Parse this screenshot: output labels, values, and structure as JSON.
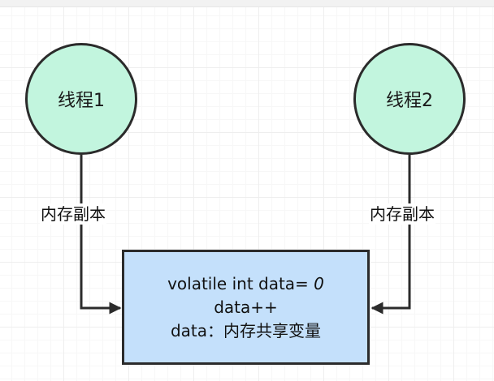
{
  "nodes": {
    "thread1": {
      "label": "线程1"
    },
    "thread2": {
      "label": "线程2"
    }
  },
  "edges": {
    "left_label": "内存副本",
    "right_label": "内存副本"
  },
  "shared_memory": {
    "line1_prefix": "volatile int data=",
    "line1_value": " 0",
    "line2": "data++",
    "line3": "data：内存共享变量"
  },
  "colors": {
    "thread_fill": "#c2f5de",
    "memory_fill": "#c4e0fb",
    "stroke": "#2b2b2b"
  }
}
